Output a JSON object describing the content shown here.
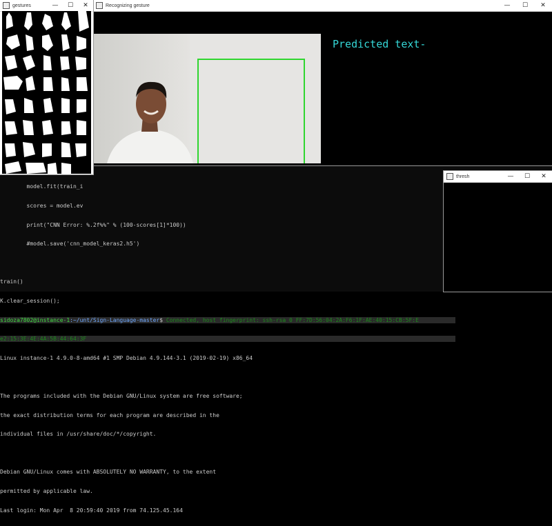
{
  "windows": {
    "gestures": {
      "title": "gestures"
    },
    "recognizing": {
      "title": "Recognizing gesture",
      "predicted_text": "Predicted text-"
    },
    "thresh": {
      "title": "thresh"
    }
  },
  "window_buttons": {
    "minimize": "—",
    "maximize": "☐",
    "close": "✕"
  },
  "terminal": {
    "code_partial": [
      "        model.fit(train_i",
      "        scores = model.ev",
      "        print(\"CNN Error: %.2f%%\" % (100-scores[1]*100))",
      "        #model.save('cnn_model_keras2.h5')",
      "",
      "train()",
      "K.clear_session();"
    ],
    "prompt_user": "sidoza7802@instance-1",
    "prompt_path": ":~/unt/Sign-Language-master",
    "prompt_symbol": "$",
    "ssh_message": " Connected, host fingerprint: ssh-rsa 0 FF:7D:56:04:2A:F6:1F:AE:40:15:CB:5F:E",
    "ssh_message_cont": "e2:15:3E:4E:4A:5B:44:64:3F",
    "output": [
      "Linux instance-1 4.9.0-8-amd64 #1 SMP Debian 4.9.144-3.1 (2019-02-19) x86_64",
      "",
      "The programs included with the Debian GNU/Linux system are free software;",
      "the exact distribution terms for each program are described in the",
      "individual files in /usr/share/doc/*/copyright.",
      "",
      "Debian GNU/Linux comes with ABSOLUTELY NO WARRANTY, to the extent",
      "permitted by applicable law.",
      "Last login: Mon Apr  8 20:59:40 2019 from 74.125.45.164"
    ]
  },
  "colors": {
    "roi_box": "#2fd62f",
    "predicted_text": "#35d7d7",
    "prompt_user": "#3fdc3f"
  }
}
